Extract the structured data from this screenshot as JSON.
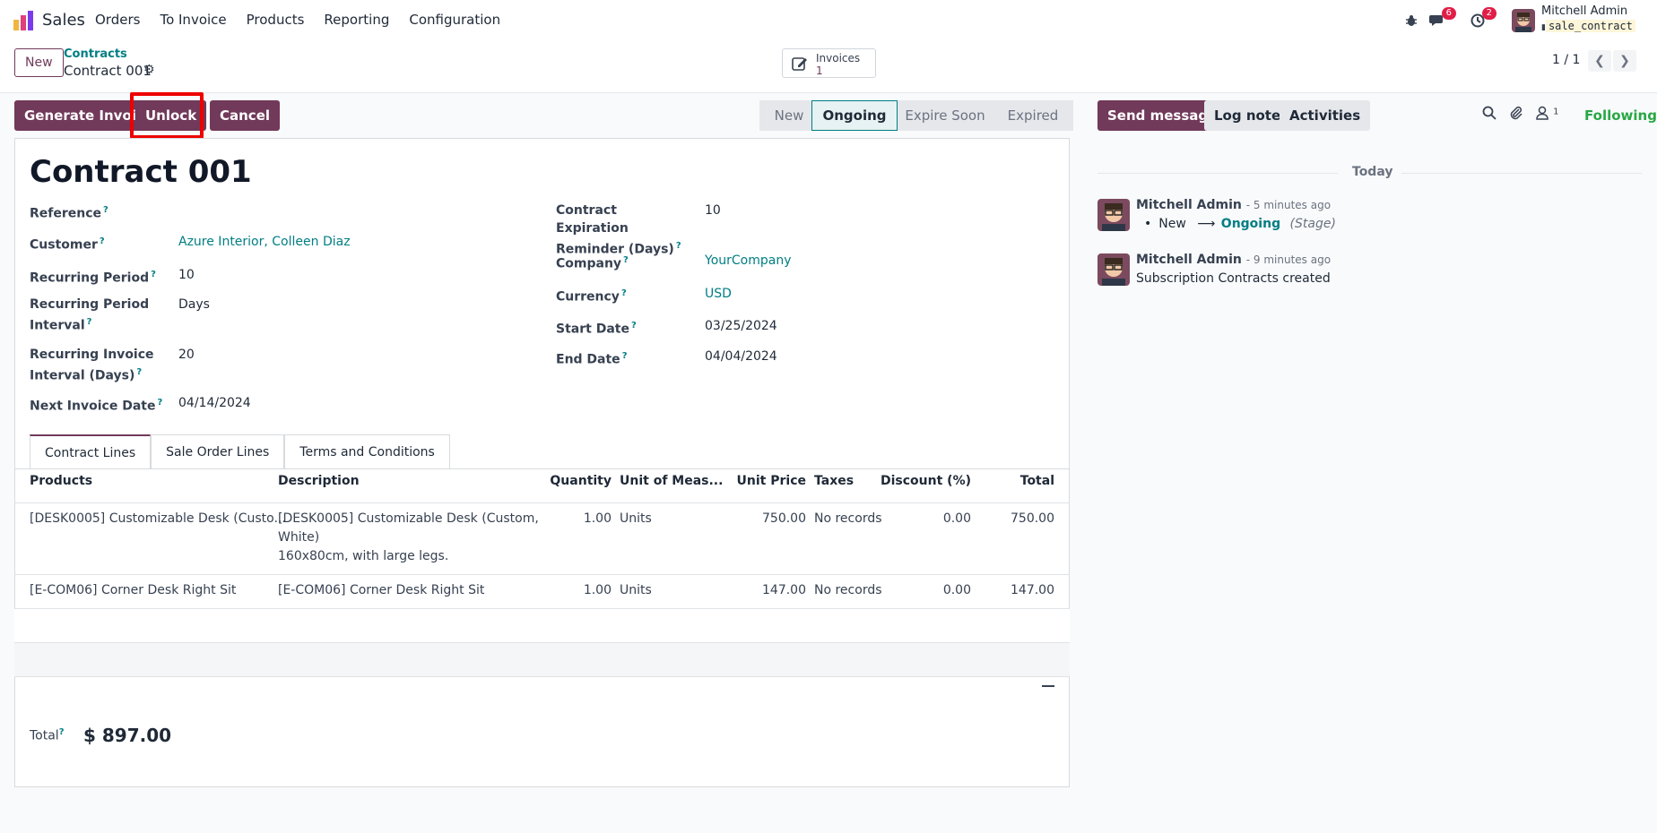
{
  "app": {
    "name": "Sales"
  },
  "menu": {
    "items": [
      "Orders",
      "To Invoice",
      "Products",
      "Reporting",
      "Configuration"
    ]
  },
  "systray": {
    "messages_count": "6",
    "activities_count": "2",
    "user_name": "Mitchell Admin",
    "db_name": "sale_contract"
  },
  "control_panel": {
    "new_label": "New",
    "breadcrumb_parent": "Contracts",
    "breadcrumb_current": "Contract 001",
    "smart_button": {
      "label": "Invoices",
      "count": "1"
    },
    "pager": "1 / 1"
  },
  "actions": {
    "generate_invoice": "Generate Invoice",
    "unlock": "Unlock",
    "cancel": "Cancel"
  },
  "status": {
    "stages": [
      "New",
      "Ongoing",
      "Expire Soon",
      "Expired"
    ],
    "current": "Ongoing"
  },
  "record": {
    "title": "Contract 001",
    "help_mark": "?",
    "left_fields": [
      {
        "label": "Reference",
        "value": ""
      },
      {
        "label": "Customer",
        "value": "Azure Interior, Colleen Diaz"
      },
      {
        "label": "Recurring Period",
        "value": "10"
      },
      {
        "label": "Recurring Period Interval",
        "value": "Days"
      },
      {
        "label": "Recurring Invoice Interval (Days)",
        "value": "20"
      },
      {
        "label": "Next Invoice Date",
        "value": "04/14/2024"
      }
    ],
    "right_fields": [
      {
        "label": "Contract Expiration Reminder (Days)",
        "value": "10"
      },
      {
        "label": "Company",
        "value": "YourCompany"
      },
      {
        "label": "Currency",
        "value": "USD"
      },
      {
        "label": "Start Date",
        "value": "03/25/2024"
      },
      {
        "label": "End Date",
        "value": "04/04/2024"
      }
    ]
  },
  "tabs": [
    "Contract Lines",
    "Sale Order Lines",
    "Terms and Conditions"
  ],
  "lines": {
    "columns": [
      "Products",
      "Description",
      "Quantity",
      "Unit of Meas...",
      "Unit Price",
      "Taxes",
      "Discount (%)",
      "Total"
    ],
    "rows": [
      {
        "product": "[DESK0005] Customizable Desk (Custo...",
        "description_1": "[DESK0005] Customizable Desk (Custom,",
        "description_2": "White)",
        "description_3": "160x80cm, with large legs.",
        "quantity": "1.00",
        "uom": "Units",
        "unit_price": "750.00",
        "taxes": "No records",
        "discount": "0.00",
        "total": "750.00"
      },
      {
        "product": "[E-COM06] Corner Desk Right Sit",
        "description_1": "[E-COM06] Corner Desk Right Sit",
        "quantity": "1.00",
        "uom": "Units",
        "unit_price": "147.00",
        "taxes": "No records",
        "discount": "0.00",
        "total": "147.00"
      }
    ]
  },
  "totals": {
    "label": "Total",
    "amount": "$ 897.00"
  },
  "chatter": {
    "send_message": "Send message",
    "log_note": "Log note",
    "activities": "Activities",
    "followers_count": "1",
    "following": "Following",
    "date_separator": "Today",
    "messages": [
      {
        "author": "Mitchell Admin",
        "time": "- 5 minutes ago",
        "tracking_old": "New",
        "tracking_new": "Ongoing",
        "tracking_field": "(Stage)"
      },
      {
        "author": "Mitchell Admin",
        "time": "- 9 minutes ago",
        "body": "Subscription Contracts created"
      }
    ]
  },
  "colors": {
    "primary": "#71395a",
    "link": "#017e84",
    "following": "#28a745",
    "badge": "#e11d48",
    "highlight": "#e00000"
  }
}
